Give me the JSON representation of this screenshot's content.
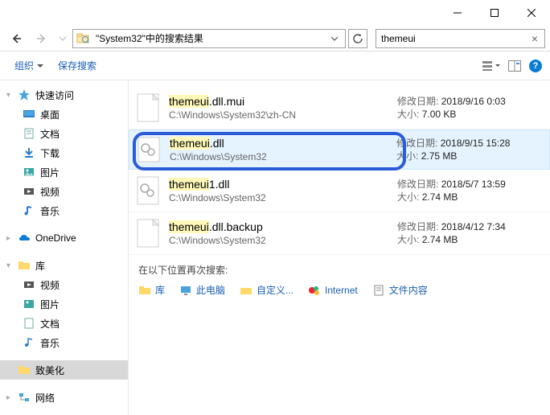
{
  "window": {
    "breadcrumb": "\"System32\"中的搜索结果",
    "search_value": "themeui"
  },
  "toolbar": {
    "organize": "组织",
    "save_search": "保存搜索"
  },
  "sidebar": {
    "quick_access": "快速访问",
    "desktop": "桌面",
    "documents": "文档",
    "downloads": "下载",
    "pictures": "图片",
    "videos": "视频",
    "music": "音乐",
    "onedrive": "OneDrive",
    "libraries": "库",
    "lib_videos": "视频",
    "lib_pictures": "图片",
    "lib_documents": "文档",
    "lib_music": "音乐",
    "customize": "致美化",
    "network": "网络"
  },
  "results": [
    {
      "name_prefix": "themeui",
      "name_suffix": ".dll.mui",
      "path": "C:\\Windows\\System32\\zh-CN",
      "date_label": "修改日期:",
      "date": "2018/9/16 0:03",
      "size_label": "大小:",
      "size": "7.00 KB"
    },
    {
      "name_prefix": "themeui",
      "name_suffix": ".dll",
      "path": "C:\\Windows\\System32",
      "date_label": "修改日期:",
      "date": "2018/9/15 15:28",
      "size_label": "大小:",
      "size": "2.75 MB"
    },
    {
      "name_prefix": "themeui",
      "name_suffix": "1.dll",
      "path": "C:\\Windows\\System32",
      "date_label": "修改日期:",
      "date": "2018/5/7 13:59",
      "size_label": "大小:",
      "size": "2.74 MB"
    },
    {
      "name_prefix": "themeui",
      "name_suffix": ".dll.backup",
      "path": "C:\\Windows\\System32",
      "date_label": "修改日期:",
      "date": "2018/4/12 7:34",
      "size_label": "大小:",
      "size": "2.74 MB"
    }
  ],
  "search_again": {
    "label": "在以下位置再次搜索:",
    "libraries": "库",
    "this_pc": "此电脑",
    "custom": "自定义...",
    "internet": "Internet",
    "file_content": "文件内容"
  }
}
